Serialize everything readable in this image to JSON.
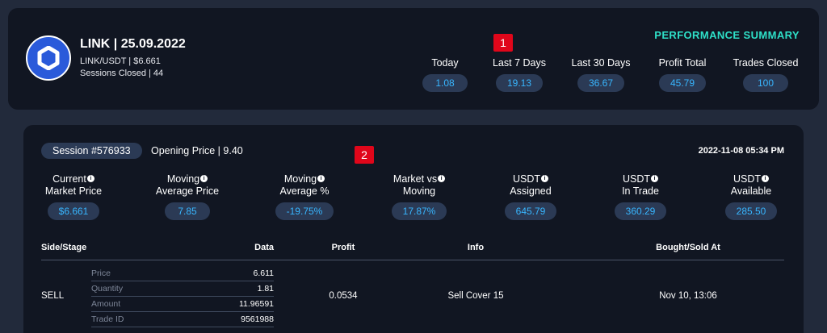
{
  "summary": {
    "title": "LINK | 25.09.2022",
    "pair_line": "LINK/USDT | $6.661",
    "sessions_line": "Sessions Closed | 44",
    "heading": "PERFORMANCE SUMMARY",
    "stats": [
      {
        "label": "Today",
        "value": "1.08"
      },
      {
        "label": "Last 7 Days",
        "value": "19.13"
      },
      {
        "label": "Last 30 Days",
        "value": "36.67"
      },
      {
        "label": "Profit Total",
        "value": "45.79"
      },
      {
        "label": "Trades Closed",
        "value": "100"
      }
    ]
  },
  "markers": {
    "one": "1",
    "two": "2"
  },
  "session": {
    "id_label": "Session #576933",
    "opening_price": "Opening Price | 9.40",
    "datetime": "2022-11-08 05:34 PM",
    "metrics": [
      {
        "line1": "Current",
        "line2": "Market Price",
        "value": "$6.661"
      },
      {
        "line1": "Moving",
        "line2": "Average Price",
        "value": "7.85"
      },
      {
        "line1": "Moving",
        "line2": "Average %",
        "value": "-19.75%"
      },
      {
        "line1": "Market vs",
        "line2": "Moving",
        "value": "17.87%"
      },
      {
        "line1": "USDT",
        "line2": "Assigned",
        "value": "645.79"
      },
      {
        "line1": "USDT",
        "line2": "In Trade",
        "value": "360.29"
      },
      {
        "line1": "USDT",
        "line2": "Available",
        "value": "285.50"
      }
    ],
    "info_glyph": "i"
  },
  "table": {
    "headers": {
      "side": "Side/Stage",
      "data": "Data",
      "profit": "Profit",
      "info": "Info",
      "bought": "Bought/Sold At"
    },
    "row": {
      "side": "SELL",
      "data": [
        {
          "k": "Price",
          "v": "6.611"
        },
        {
          "k": "Quantity",
          "v": "1.81"
        },
        {
          "k": "Amount",
          "v": "11.96591"
        },
        {
          "k": "Trade ID",
          "v": "9561988"
        }
      ],
      "profit": "0.0534",
      "info": "Sell Cover 15",
      "bought": "Nov 10, 13:06"
    }
  },
  "colors": {
    "accent": "#2ee0c8",
    "pill_text": "#38b6ff",
    "pill_bg": "#2b3a55",
    "marker": "#e0061a",
    "card": "#111622",
    "page": "#222a3b",
    "logo": "#2a5ada"
  },
  "icons": {
    "logo": "chainlink-hexagon-icon",
    "info": "info-icon"
  }
}
